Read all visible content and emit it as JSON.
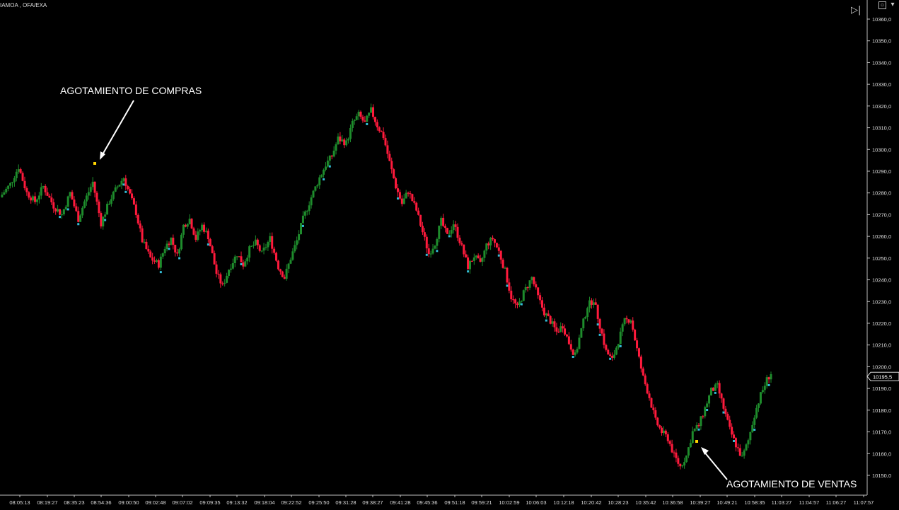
{
  "chart_title": "IAMOA , OFA/EXA",
  "controls": {
    "window_button": "▫",
    "menu_button": "▾",
    "play_to_end_button": "▷|"
  },
  "price_marker": "10195,5",
  "colors": {
    "background": "#000000",
    "bull": "#1e8c2c",
    "bear": "#ff1a3c",
    "signal_up": "#33bcd6",
    "signal_exhaust": "#ffd400",
    "axis": "#bbbbbb",
    "text": "#ffffff"
  },
  "annotations": [
    {
      "name": "annotation-agotamiento-compras",
      "text": "AGOTAMIENTO DE COMPRAS"
    },
    {
      "name": "annotation-agotamiento-ventas",
      "text": "AGOTAMIENTO DE VENTAS"
    }
  ],
  "chart_data": {
    "type": "candlestick",
    "title": "IAMOA , OFA/EXA",
    "ylim": [
      10145,
      10365
    ],
    "y_ticks": [
      10150,
      10160,
      10170,
      10180,
      10190,
      10200,
      10210,
      10220,
      10230,
      10240,
      10250,
      10260,
      10270,
      10280,
      10290,
      10300,
      10310,
      10320,
      10330,
      10340,
      10350,
      10360
    ],
    "y_tick_labels": [
      "10150,0",
      "10160,0",
      "10170,0",
      "10180,0",
      "10190,0",
      "10200,0",
      "10210,0",
      "10220,0",
      "10230,0",
      "10240,0",
      "10250,0",
      "10260,0",
      "10270,0",
      "10280,0",
      "10290,0",
      "10300,0",
      "10310,0",
      "10320,0",
      "10330,0",
      "10340,0",
      "10350,0",
      "10360,0"
    ],
    "x_ticks": [
      "08:05:13",
      "08:19:27",
      "08:35:23",
      "08:54:36",
      "09:00:50",
      "09:02:48",
      "09:07:02",
      "09:09:35",
      "09:13:32",
      "09:18:04",
      "09:22:52",
      "09:25:50",
      "09:31:28",
      "09:38:27",
      "09:41:28",
      "09:45:36",
      "09:51:18",
      "09:59:21",
      "10:02:59",
      "10:06:03",
      "10:12:18",
      "10:20:42",
      "10:28:23",
      "10:35:42",
      "10:36:58",
      "10:39:27",
      "10:49:21",
      "10:58:35",
      "11:03:27",
      "11:04:57",
      "11:06:27",
      "11:07:57"
    ],
    "last_price": 10195.5,
    "close_path": [
      [
        0,
        10278
      ],
      [
        5,
        10284
      ],
      [
        9,
        10292
      ],
      [
        13,
        10280
      ],
      [
        17,
        10276
      ],
      [
        21,
        10283
      ],
      [
        26,
        10274
      ],
      [
        30,
        10270
      ],
      [
        34,
        10280
      ],
      [
        38,
        10268
      ],
      [
        41,
        10276
      ],
      [
        45,
        10285
      ],
      [
        49,
        10266
      ],
      [
        53,
        10276
      ],
      [
        57,
        10283
      ],
      [
        60,
        10287
      ],
      [
        63,
        10279
      ],
      [
        66,
        10271
      ],
      [
        69,
        10258
      ],
      [
        73,
        10250
      ],
      [
        77,
        10247
      ],
      [
        80,
        10255
      ],
      [
        83,
        10259
      ],
      [
        86,
        10251
      ],
      [
        89,
        10265
      ],
      [
        92,
        10268
      ],
      [
        95,
        10259
      ],
      [
        98,
        10265
      ],
      [
        101,
        10260
      ],
      [
        105,
        10243
      ],
      [
        108,
        10237
      ],
      [
        111,
        10245
      ],
      [
        115,
        10252
      ],
      [
        118,
        10247
      ],
      [
        121,
        10254
      ],
      [
        124,
        10257
      ],
      [
        127,
        10252
      ],
      [
        131,
        10259
      ],
      [
        135,
        10246
      ],
      [
        138,
        10241
      ],
      [
        141,
        10250
      ],
      [
        144,
        10258
      ],
      [
        147,
        10268
      ],
      [
        151,
        10278
      ],
      [
        155,
        10287
      ],
      [
        158,
        10293
      ],
      [
        161,
        10297
      ],
      [
        164,
        10305
      ],
      [
        168,
        10303
      ],
      [
        171,
        10312
      ],
      [
        174,
        10316
      ],
      [
        177,
        10312
      ],
      [
        180,
        10318
      ],
      [
        183,
        10311
      ],
      [
        186,
        10306
      ],
      [
        189,
        10294
      ],
      [
        192,
        10283
      ],
      [
        195,
        10275
      ],
      [
        198,
        10281
      ],
      [
        202,
        10272
      ],
      [
        205,
        10262
      ],
      [
        208,
        10252
      ],
      [
        211,
        10257
      ],
      [
        214,
        10267
      ],
      [
        217,
        10260
      ],
      [
        220,
        10266
      ],
      [
        223,
        10258
      ],
      [
        227,
        10246
      ],
      [
        230,
        10251
      ],
      [
        233,
        10247
      ],
      [
        236,
        10256
      ],
      [
        239,
        10259
      ],
      [
        242,
        10253
      ],
      [
        245,
        10244
      ],
      [
        248,
        10232
      ],
      [
        251,
        10227
      ],
      [
        254,
        10234
      ],
      [
        258,
        10241
      ],
      [
        261,
        10232
      ],
      [
        264,
        10225
      ],
      [
        267,
        10221
      ],
      [
        270,
        10216
      ],
      [
        273,
        10219
      ],
      [
        276,
        10211
      ],
      [
        279,
        10205
      ],
      [
        282,
        10217
      ],
      [
        285,
        10228
      ],
      [
        288,
        10231
      ],
      [
        291,
        10219
      ],
      [
        294,
        10207
      ],
      [
        297,
        10203
      ],
      [
        300,
        10212
      ],
      [
        303,
        10221
      ],
      [
        306,
        10222
      ],
      [
        309,
        10208
      ],
      [
        312,
        10195
      ],
      [
        315,
        10186
      ],
      [
        318,
        10175
      ],
      [
        321,
        10170
      ],
      [
        324,
        10167
      ],
      [
        327,
        10159
      ],
      [
        330,
        10154
      ],
      [
        333,
        10159
      ],
      [
        336,
        10170
      ],
      [
        339,
        10173
      ],
      [
        342,
        10181
      ],
      [
        345,
        10189
      ],
      [
        348,
        10191
      ],
      [
        351,
        10181
      ],
      [
        354,
        10171
      ],
      [
        357,
        10164
      ],
      [
        360,
        10158
      ],
      [
        363,
        10166
      ],
      [
        366,
        10178
      ],
      [
        369,
        10187
      ],
      [
        372,
        10194
      ],
      [
        374,
        10197
      ]
    ]
  }
}
